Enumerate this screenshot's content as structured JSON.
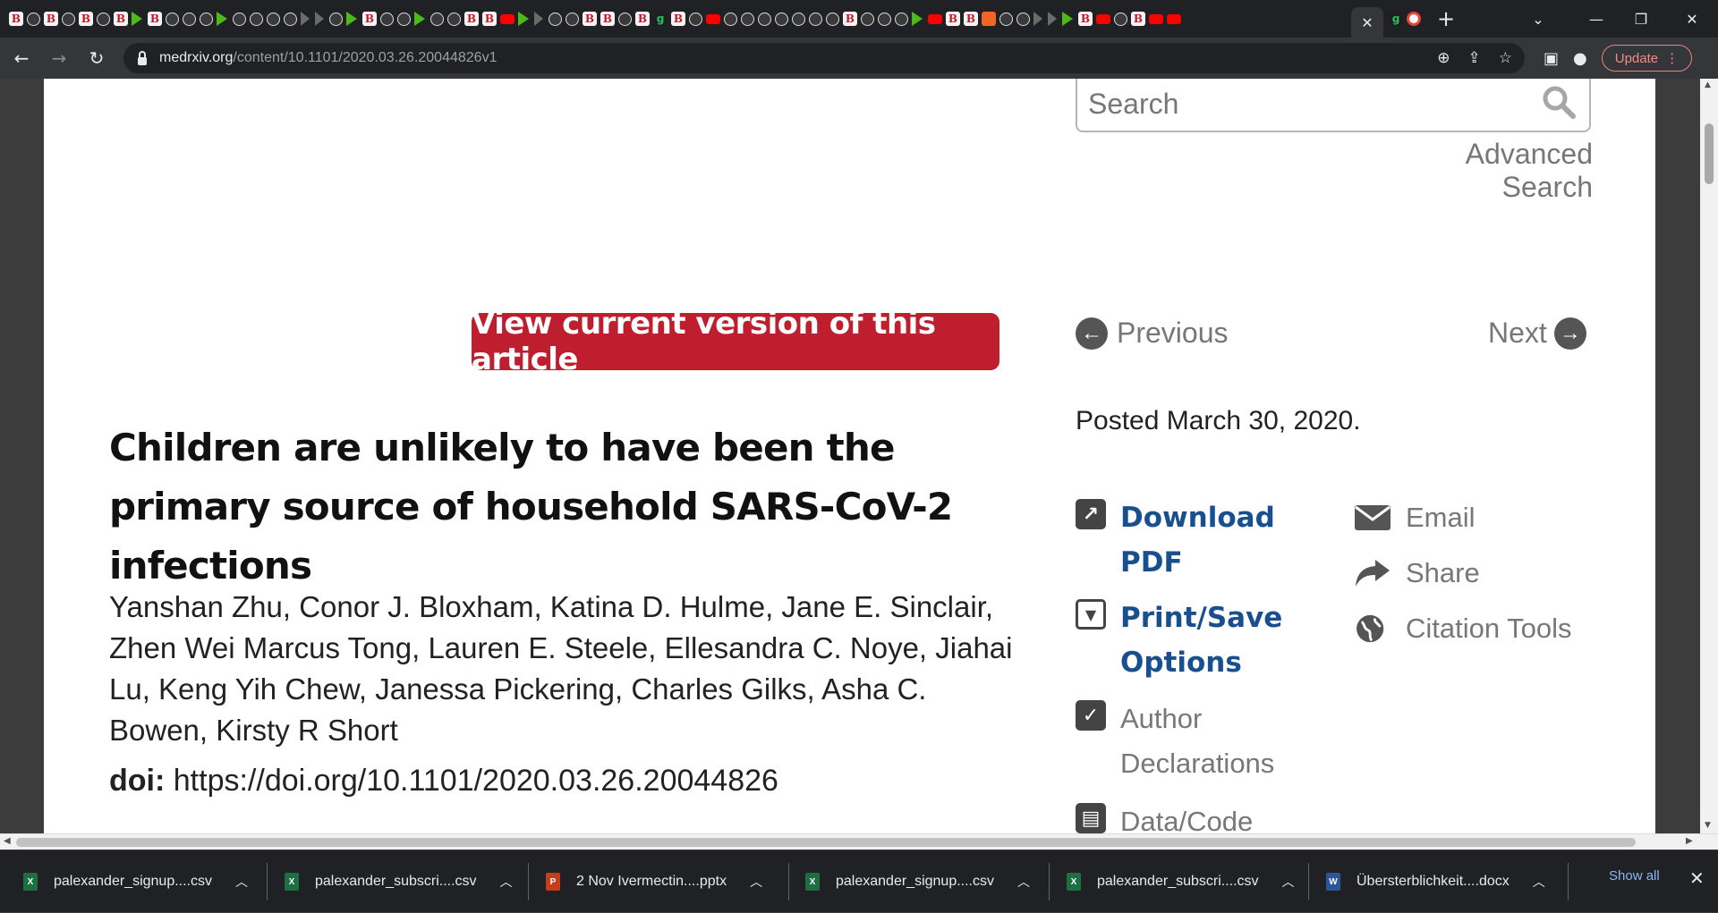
{
  "browser": {
    "url_host": "medrxiv.org",
    "url_path": "/content/10.1101/2020.03.26.20044826v1",
    "update_label": "Update",
    "active_tab_close": "✕",
    "new_tab": "+",
    "tab_favicons": [
      "b",
      "c",
      "b",
      "c",
      "b",
      "c",
      "b",
      "p",
      "b",
      "c",
      "c",
      "c",
      "p",
      "c",
      "c",
      "c",
      "c",
      "d",
      "d",
      "c",
      "p",
      "b",
      "c",
      "x",
      "p",
      "c",
      "c",
      "r",
      "b",
      "y",
      "p",
      "d",
      "c",
      "c",
      "b",
      "b",
      "m",
      "b",
      "g",
      "b",
      "c",
      "y",
      "c",
      "c",
      "s",
      "c",
      "c",
      "c",
      "c",
      "b",
      "c",
      "c",
      "c",
      "p",
      "y",
      "b",
      "r",
      "o",
      "c",
      "c",
      "d",
      "d",
      "p",
      "b",
      "y",
      "m",
      "b",
      "y",
      "y"
    ]
  },
  "page": {
    "search_placeholder": "Search",
    "advanced_search": "Advanced Search",
    "view_current_label": "View current version of this article",
    "previous_label": "Previous",
    "next_label": "Next",
    "posted": "Posted March 30, 2020.",
    "title": "Children are unlikely to have been the primary source of household SARS-CoV-2 infections",
    "authors": "Yanshan Zhu, Conor J. Bloxham, Katina D. Hulme, Jane E. Sinclair, Zhen Wei Marcus Tong, Lauren E. Steele, Ellesandra C. Noye, Jiahai Lu, Keng Yih Chew, Janessa Pickering, Charles Gilks, Asha C. Bowen, Kirsty R Short",
    "doi_label": "doi:",
    "doi_value": "https://doi.org/10.1101/2020.03.26.20044826",
    "tools_left": [
      {
        "label": "Download PDF",
        "icon": "external-link-icon"
      },
      {
        "label": "Print/Save Options",
        "icon": "print-save-icon"
      },
      {
        "label": "Author Declarations",
        "icon": "checkbox-icon"
      },
      {
        "label": "Data/Code",
        "icon": "data-code-icon"
      }
    ],
    "tools_right": [
      {
        "label": "Email",
        "icon": "envelope-icon"
      },
      {
        "label": "Share",
        "icon": "share-icon"
      },
      {
        "label": "Citation Tools",
        "icon": "globe-icon"
      }
    ]
  },
  "downloads": {
    "items": [
      {
        "name": "palexander_signup....csv",
        "type": "excel"
      },
      {
        "name": "palexander_subscri....csv",
        "type": "excel"
      },
      {
        "name": "2 Nov Ivermectin....pptx",
        "type": "powerpoint"
      },
      {
        "name": "palexander_signup....csv",
        "type": "excel"
      },
      {
        "name": "palexander_subscri....csv",
        "type": "excel"
      },
      {
        "name": "Übersterblichkeit....docx",
        "type": "word"
      }
    ],
    "show_all": "Show all",
    "close": "✕"
  },
  "colors": {
    "accent_red": "#bf1e2e",
    "link_blue": "#174f90",
    "chrome_dark": "#202124",
    "chrome_toolbar": "#35363a"
  }
}
